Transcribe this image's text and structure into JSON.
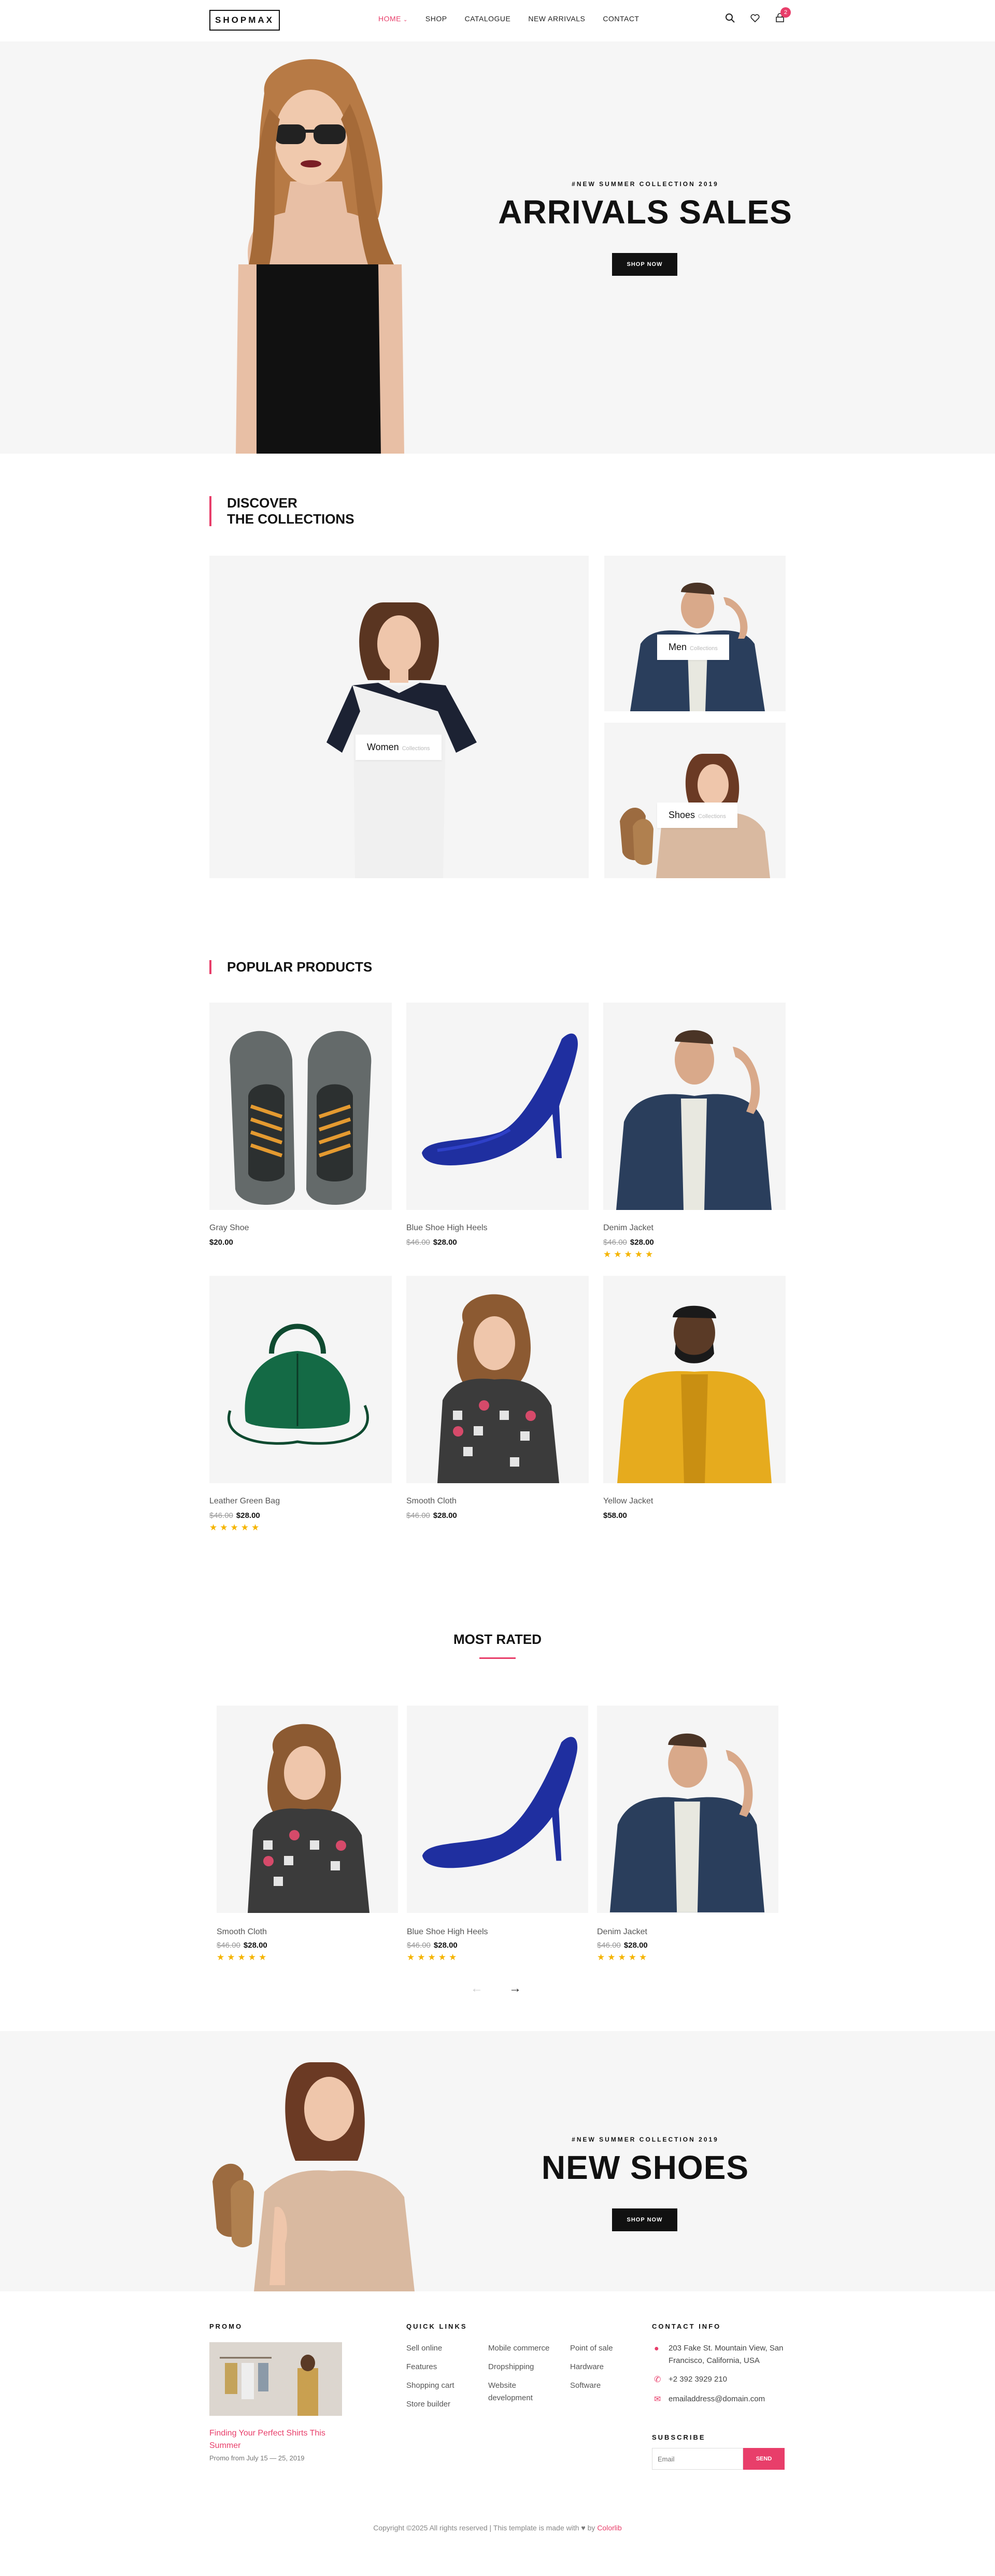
{
  "brand": "SHOPMAX",
  "nav": [
    {
      "label": "HOME",
      "active": true
    },
    {
      "label": "SHOP"
    },
    {
      "label": "CATALOGUE"
    },
    {
      "label": "NEW ARRIVALS"
    },
    {
      "label": "CONTACT"
    }
  ],
  "cart_count": "2",
  "hero": {
    "eyebrow": "#NEW SUMMER COLLECTION 2019",
    "title": "ARRIVALS SALES",
    "cta": "SHOP NOW"
  },
  "collections": {
    "title_line1": "DISCOVER",
    "title_line2": "THE COLLECTIONS",
    "items": [
      {
        "label": "Women",
        "sub": "Collections"
      },
      {
        "label": "Men",
        "sub": "Collections"
      },
      {
        "label": "Shoes",
        "sub": "Collections"
      }
    ]
  },
  "popular": {
    "title": "POPULAR PRODUCTS",
    "products": [
      {
        "name": "Gray Shoe",
        "old": "",
        "price": "$20.00",
        "rating": 0
      },
      {
        "name": "Blue Shoe High Heels",
        "old": "$46.00",
        "price": "$28.00",
        "rating": 0
      },
      {
        "name": "Denim Jacket",
        "old": "$46.00",
        "price": "$28.00",
        "rating": 5
      },
      {
        "name": "Leather Green Bag",
        "old": "$46.00",
        "price": "$28.00",
        "rating": 5
      },
      {
        "name": "Smooth Cloth",
        "old": "$46.00",
        "price": "$28.00",
        "rating": 0
      },
      {
        "name": "Yellow Jacket",
        "old": "",
        "price": "$58.00",
        "rating": 0
      }
    ]
  },
  "most_rated": {
    "title": "MOST RATED",
    "products": [
      {
        "name": "Smooth Cloth",
        "old": "$46.00",
        "price": "$28.00",
        "rating": 5
      },
      {
        "name": "Blue Shoe High Heels",
        "old": "$46.00",
        "price": "$28.00",
        "rating": 5
      },
      {
        "name": "Denim Jacket",
        "old": "$46.00",
        "price": "$28.00",
        "rating": 5
      }
    ]
  },
  "promo_banner": {
    "eyebrow": "#NEW SUMMER COLLECTION 2019",
    "title": "NEW SHOES",
    "cta": "SHOP NOW"
  },
  "footer": {
    "promo_heading": "PROMO",
    "promo_title": "Finding Your Perfect Shirts This Summer",
    "promo_date": "Promo from July 15 — 25, 2019",
    "links_heading": "QUICK LINKS",
    "links_col1": [
      "Sell online",
      "Features",
      "Shopping cart",
      "Store builder"
    ],
    "links_col2": [
      "Mobile commerce",
      "Dropshipping",
      "Website development"
    ],
    "links_col3": [
      "Point of sale",
      "Hardware",
      "Software"
    ],
    "contact_heading": "CONTACT INFO",
    "address": "203 Fake St. Mountain View, San Francisco, California, USA",
    "phone": "+2 392 3929 210",
    "email": "emailaddress@domain.com",
    "subscribe_heading": "SUBSCRIBE",
    "subscribe_placeholder": "Email",
    "subscribe_btn": "SEND",
    "copyright": "Copyright ©2025 All rights reserved | This template is made with",
    "copyright_by": "by",
    "copyright_brand": "Colorlib"
  },
  "colors": {
    "accent": "#e83e6a",
    "dark": "#111111",
    "bg": "#f6f6f6",
    "star": "#f5b400"
  }
}
